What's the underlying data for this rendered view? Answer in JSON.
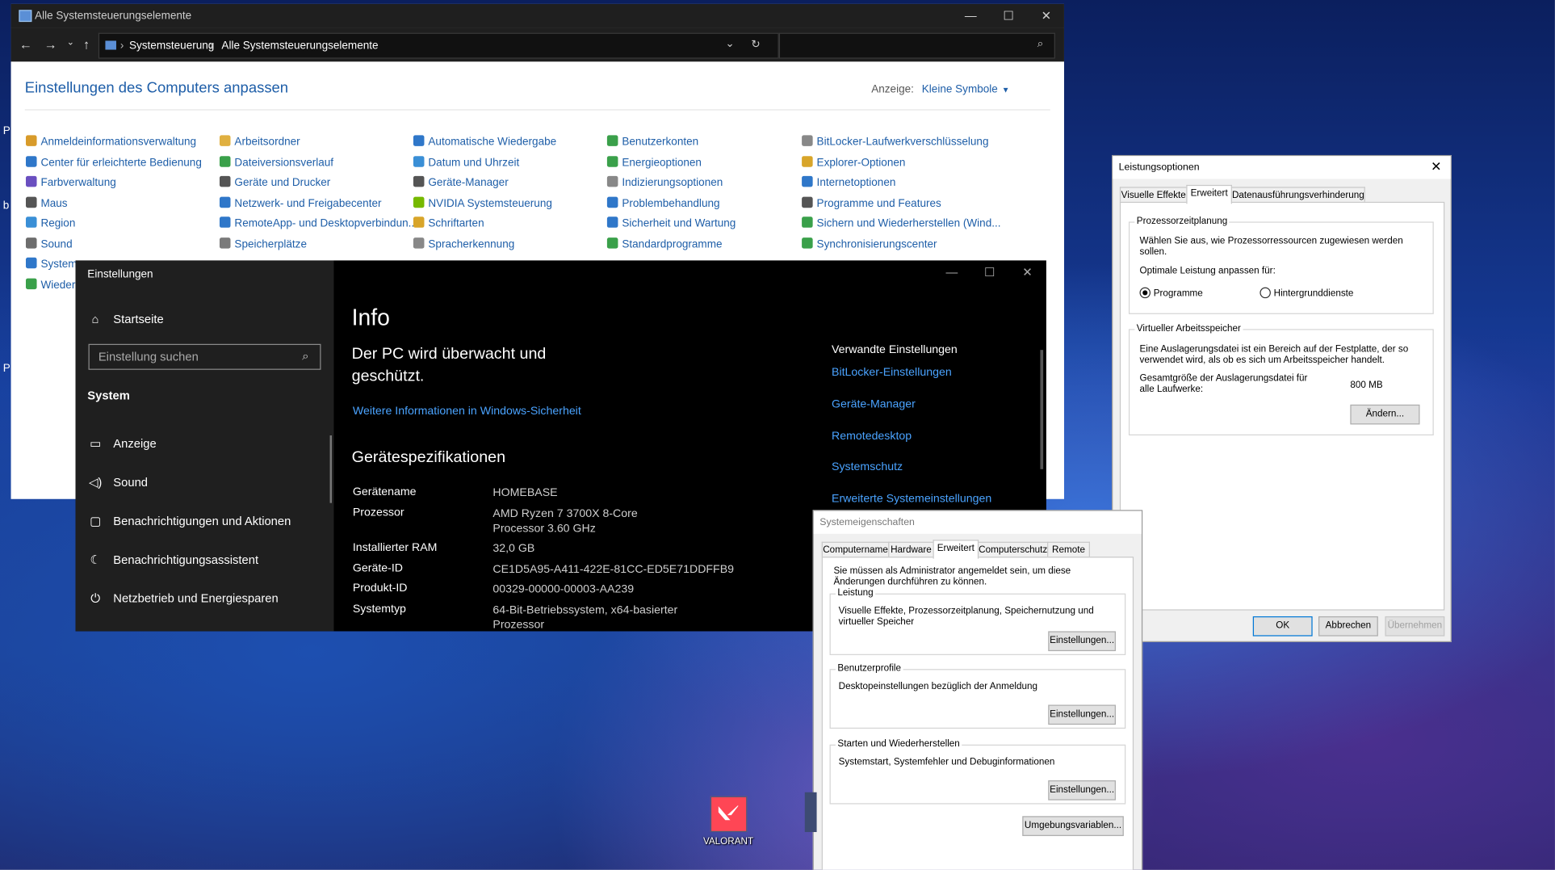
{
  "control_panel": {
    "title": "Alle Systemsteuerungselemente",
    "breadcrumb": [
      "Systemsteuerung",
      "Alle Systemsteuerungselemente"
    ],
    "heading": "Einstellungen des Computers anpassen",
    "view_label": "Anzeige:",
    "view_value": "Kleine Symbole",
    "columns": [
      [
        "Anmeldeinformationsverwaltung",
        "Center für erleichterte Bedienung",
        "Farbverwaltung",
        "Maus",
        "Region",
        "Sound",
        "System",
        "Wiederh"
      ],
      [
        "Arbeitsordner",
        "Dateiversionsverlauf",
        "Geräte und Drucker",
        "Netzwerk- und Freigabecenter",
        "RemoteApp- und Desktopverbindun...",
        "Speicherplätze"
      ],
      [
        "Automatische Wiedergabe",
        "Datum und Uhrzeit",
        "Geräte-Manager",
        "NVIDIA Systemsteuerung",
        "Schriftarten",
        "Spracherkennung"
      ],
      [
        "Benutzerkonten",
        "Energieoptionen",
        "Indizierungsoptionen",
        "Problembehandlung",
        "Sicherheit und Wartung",
        "Standardprogramme"
      ],
      [
        "BitLocker-Laufwerkverschlüsselung",
        "Explorer-Optionen",
        "Internetoptionen",
        "Programme und Features",
        "Sichern und Wiederherstellen (Wind...",
        "Synchronisierungscenter"
      ]
    ],
    "icon_colors": [
      [
        "#d89b2a",
        "#2f77c9",
        "#6a4fc0",
        "#555555",
        "#3a8fd6",
        "#6d6d6d",
        "#2f77c9",
        "#3aa04a"
      ],
      [
        "#e0b040",
        "#3aa04a",
        "#555555",
        "#2f77c9",
        "#2f77c9",
        "#7a7a7a"
      ],
      [
        "#2f77c9",
        "#3a8fd6",
        "#555555",
        "#76b900",
        "#d8a52a",
        "#888888"
      ],
      [
        "#3aa04a",
        "#3aa04a",
        "#888888",
        "#2f77c9",
        "#2f77c9",
        "#3aa04a"
      ],
      [
        "#888888",
        "#d8a52a",
        "#2f77c9",
        "#555555",
        "#3aa04a",
        "#3aa04a"
      ]
    ]
  },
  "settings": {
    "window_title": "Einstellungen",
    "home": "Startseite",
    "search_placeholder": "Einstellung suchen",
    "section": "System",
    "nav": [
      {
        "label": "Anzeige",
        "icon": "display-icon"
      },
      {
        "label": "Sound",
        "icon": "sound-icon"
      },
      {
        "label": "Benachrichtigungen und Aktionen",
        "icon": "notifications-icon"
      },
      {
        "label": "Benachrichtigungsassistent",
        "icon": "focus-assist-icon"
      },
      {
        "label": "Netzbetrieb und Energiesparen",
        "icon": "power-icon"
      }
    ],
    "page_title": "Info",
    "security_heading": "Der PC wird überwacht und geschützt.",
    "security_link": "Weitere Informationen in Windows-Sicherheit",
    "specs_heading": "Gerätespezifikationen",
    "specs": [
      {
        "label": "Gerätename",
        "value": "HOMEBASE"
      },
      {
        "label": "Prozessor",
        "value": "AMD Ryzen 7 3700X 8-Core Processor 3.60 GHz"
      },
      {
        "label": "Installierter RAM",
        "value": "32,0 GB"
      },
      {
        "label": "Geräte-ID",
        "value": "CE1D5A95-A411-422E-81CC-ED5E71DDFFB9"
      },
      {
        "label": "Produkt-ID",
        "value": "00329-00000-00003-AA239"
      },
      {
        "label": "Systemtyp",
        "value": "64-Bit-Betriebssystem, x64-basierter Prozessor"
      }
    ],
    "related_heading": "Verwandte Einstellungen",
    "related_links": [
      "BitLocker-Einstellungen",
      "Geräte-Manager",
      "Remotedesktop",
      "Systemschutz",
      "Erweiterte Systemeinstellungen"
    ]
  },
  "system_properties": {
    "title": "Systemeigenschaften",
    "tabs": [
      "Computername",
      "Hardware",
      "Erweitert",
      "Computerschutz",
      "Remote"
    ],
    "selected_tab": "Erweitert",
    "admin_note": "Sie müssen als Administrator angemeldet sein, um diese Änderungen durchführen zu können.",
    "groups": [
      {
        "title": "Leistung",
        "text": "Visuelle Effekte, Prozessorzeitplanung, Speichernutzung und virtueller Speicher",
        "button": "Einstellungen..."
      },
      {
        "title": "Benutzerprofile",
        "text": "Desktopeinstellungen bezüglich der Anmeldung",
        "button": "Einstellungen..."
      },
      {
        "title": "Starten und Wiederherstellen",
        "text": "Systemstart, Systemfehler und Debuginformationen",
        "button": "Einstellungen..."
      }
    ],
    "env_button": "Umgebungsvariablen..."
  },
  "performance_options": {
    "title": "Leistungsoptionen",
    "tabs": [
      "Visuelle Effekte",
      "Erweitert",
      "Datenausführungsverhinderung"
    ],
    "selected_tab": "Erweitert",
    "scheduling": {
      "title": "Prozessorzeitplanung",
      "text": "Wählen Sie aus, wie Prozessorressourcen zugewiesen werden sollen.",
      "subtext": "Optimale Leistung anpassen für:",
      "options": [
        "Programme",
        "Hintergrunddienste"
      ],
      "selected": "Programme"
    },
    "virtual_memory": {
      "title": "Virtueller Arbeitsspeicher",
      "text": "Eine Auslagerungsdatei ist ein Bereich auf der Festplatte, der so verwendet wird, als ob es sich um Arbeitsspeicher handelt.",
      "total_label": "Gesamtgröße der Auslagerungsdatei für alle Laufwerke:",
      "total_value": "800 MB",
      "change_button": "Ändern..."
    },
    "buttons": {
      "ok": "OK",
      "cancel": "Abbrechen",
      "apply": "Übernehmen"
    }
  },
  "desktop": {
    "icon_label": "VALORANT",
    "accent_color": "#ff4655",
    "edge_letters": [
      "P",
      "b",
      "P"
    ]
  }
}
